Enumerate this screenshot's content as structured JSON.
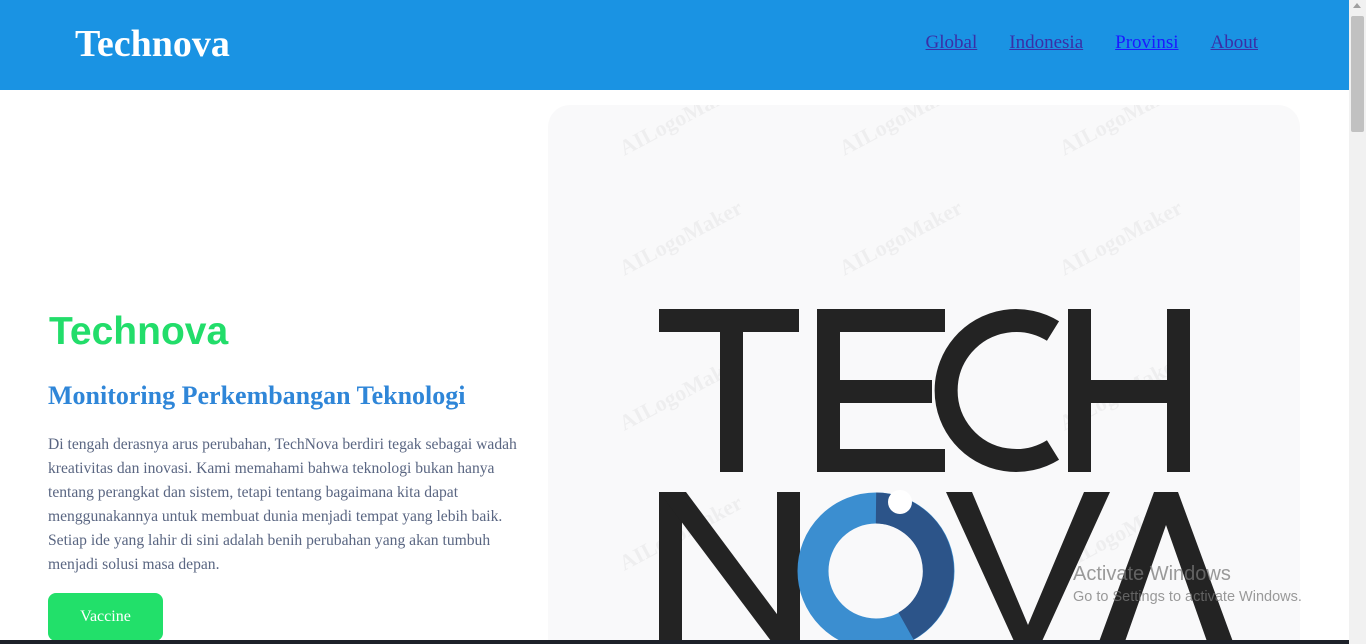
{
  "navbar": {
    "brand": "Technova",
    "links": [
      {
        "label": "Global"
      },
      {
        "label": "Indonesia"
      },
      {
        "label": "Provinsi"
      },
      {
        "label": "About"
      }
    ]
  },
  "hero": {
    "title": "Technova",
    "subtitle": "Monitoring Perkembangan Teknologi",
    "description": "Di tengah derasnya arus perubahan, TechNova berdiri tegak sebagai wadah kreativitas dan inovasi. Kami memahami bahwa teknologi bukan hanya tentang perangkat dan sistem, tetapi tentang bagaimana kita dapat menggunakannya untuk membuat dunia menjadi tempat yang lebih baik. Setiap ide yang lahir di sini adalah benih perubahan yang akan tumbuh menjadi solusi masa depan.",
    "button_label": "Vaccine"
  },
  "logo": {
    "line1": "TECH",
    "line2": "NOVA",
    "watermark": "AILogoMaker"
  },
  "system_overlay": {
    "activate_title": "Activate Windows",
    "activate_subtitle": "Go to Settings to activate Windows."
  },
  "colors": {
    "navbar": "#1a93e3",
    "hero_title": "#22dd6a",
    "subtitle": "#2f86d8",
    "button": "#22e06a",
    "logo_dark": "#232323",
    "logo_blue": "#3b8ed0",
    "logo_navy": "#2c5489"
  }
}
